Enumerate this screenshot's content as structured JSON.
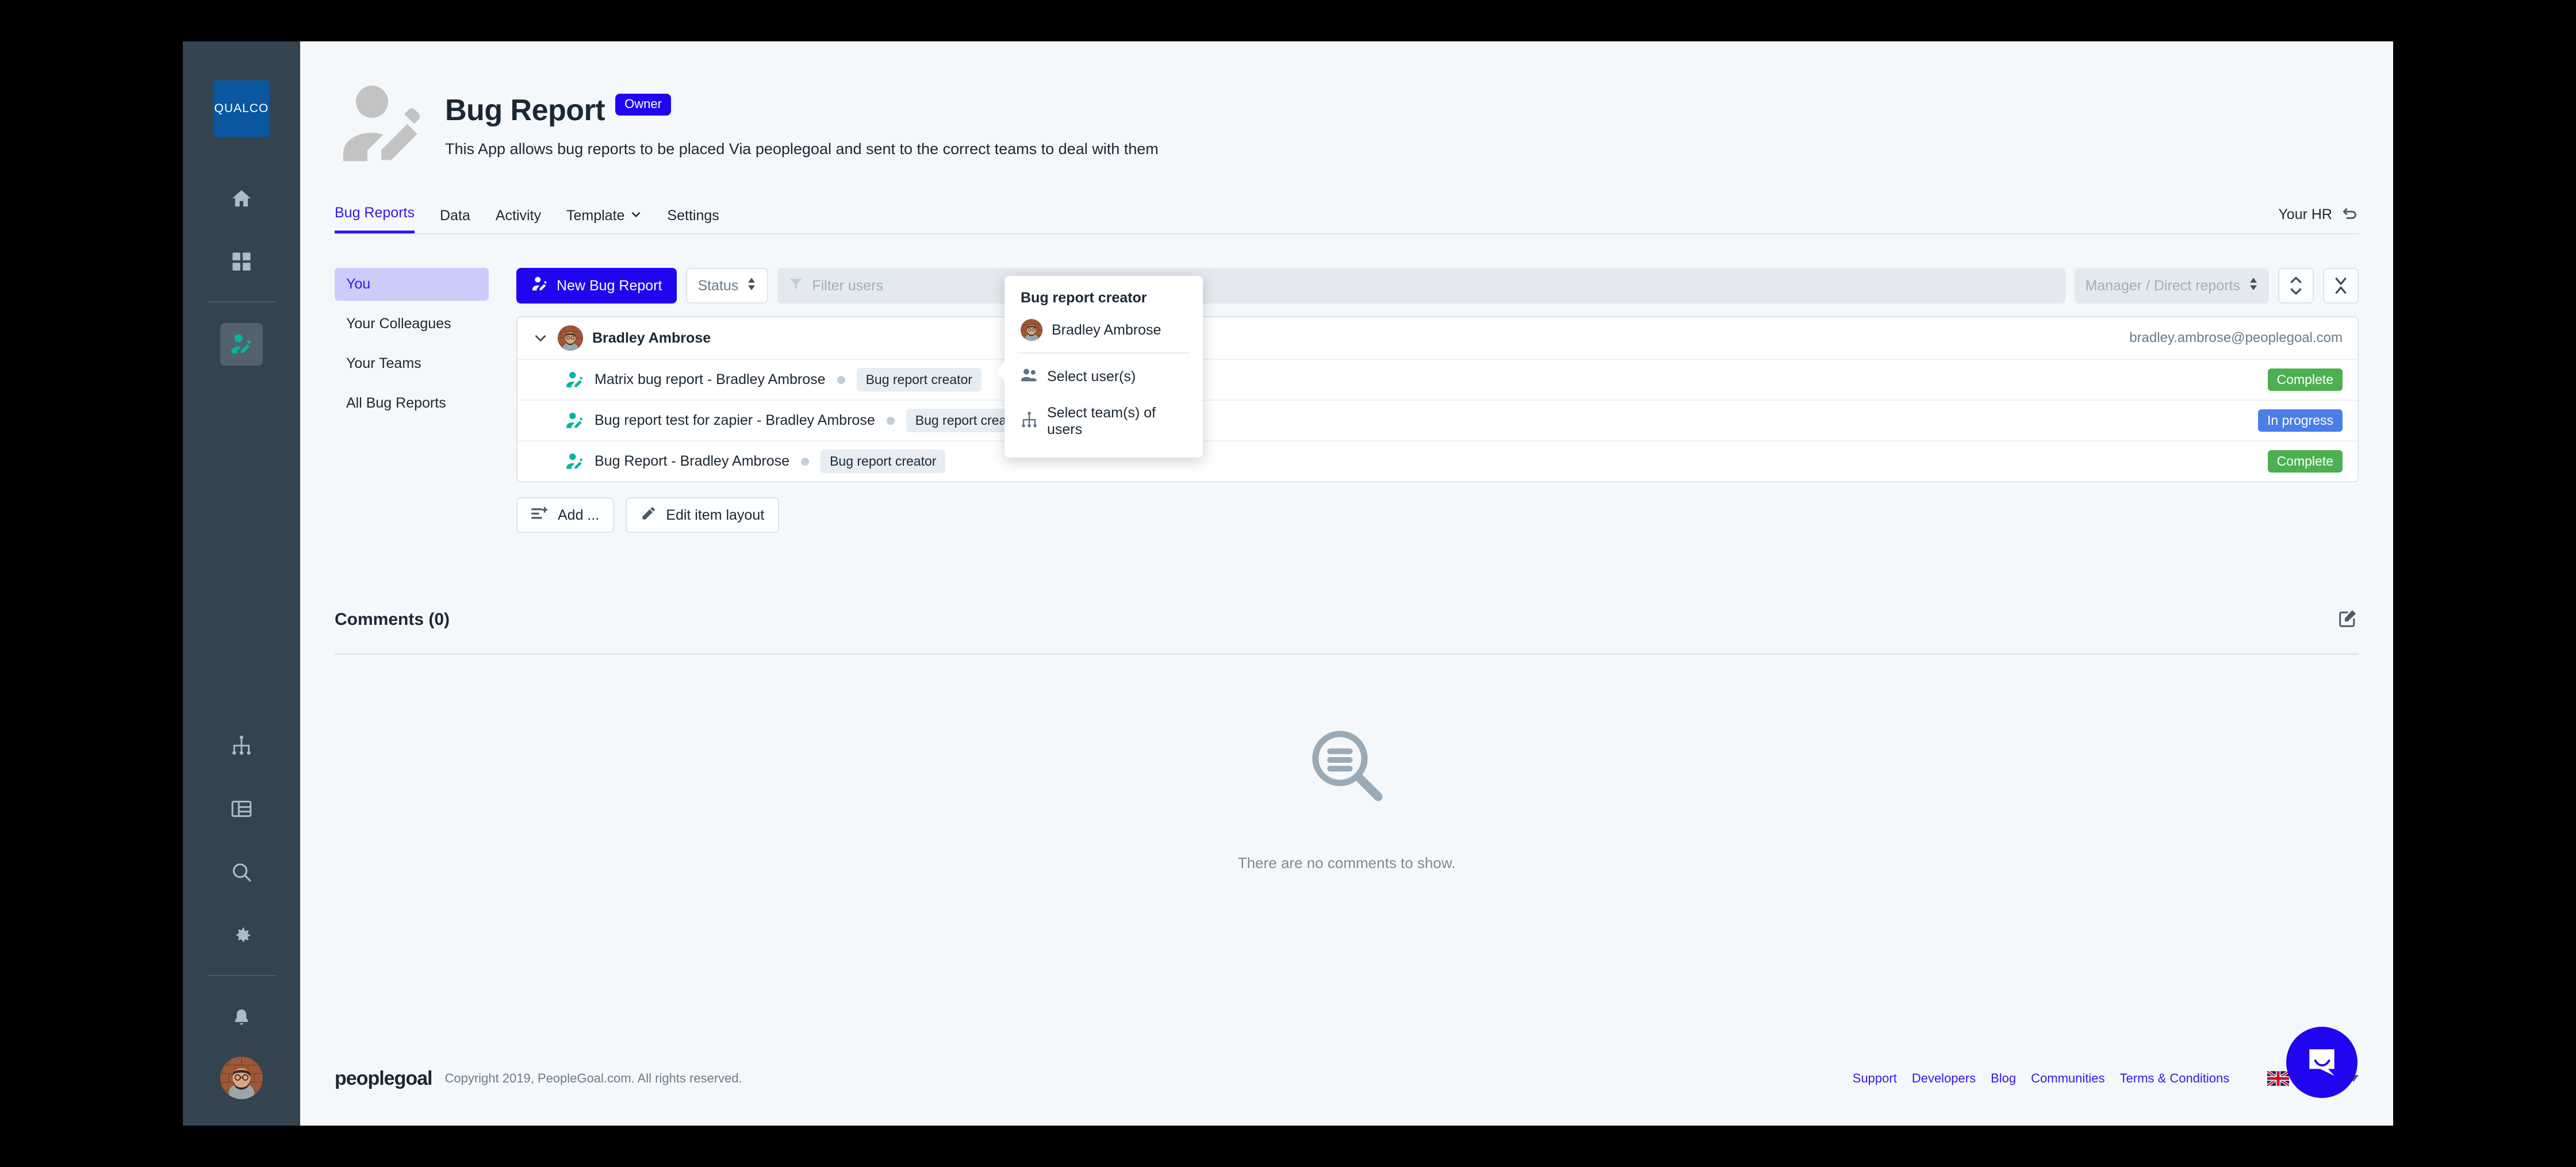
{
  "rail": {
    "brand": "QUALCO",
    "items": [
      {
        "name": "home-icon",
        "label": "Home"
      },
      {
        "name": "apps-grid-icon",
        "label": "Apps"
      },
      {
        "name": "bug-report-app-icon",
        "label": "Bug Report"
      },
      {
        "name": "org-chart-icon",
        "label": "Org chart"
      },
      {
        "name": "table-icon",
        "label": "Reports"
      },
      {
        "name": "search-icon",
        "label": "Search"
      },
      {
        "name": "gear-icon",
        "label": "Settings"
      },
      {
        "name": "bell-icon",
        "label": "Notifications"
      }
    ]
  },
  "header": {
    "title": "Bug Report",
    "badge": "Owner",
    "description": "This App allows bug reports to be placed Via peoplegoal and sent to the correct teams to deal with them"
  },
  "tabs": {
    "items": [
      {
        "label": "Bug Reports",
        "active": true,
        "caret": false
      },
      {
        "label": "Data",
        "active": false,
        "caret": false
      },
      {
        "label": "Activity",
        "active": false,
        "caret": false
      },
      {
        "label": "Template",
        "active": false,
        "caret": true
      },
      {
        "label": "Settings",
        "active": false,
        "caret": false
      }
    ],
    "right_label": "Your HR"
  },
  "sidebar_filters": {
    "items": [
      {
        "label": "You",
        "active": true
      },
      {
        "label": "Your Colleagues",
        "active": false
      },
      {
        "label": "Your Teams",
        "active": false
      },
      {
        "label": "All Bug Reports",
        "active": false
      }
    ]
  },
  "toolbar": {
    "new_button": "New Bug Report",
    "status_select": "Status",
    "filter_placeholder": "Filter users",
    "manager_select": "Manager / Direct reports",
    "expand_collapse_icon": "expand-collapse-icon",
    "collapse_all_icon": "collapse-all-icon"
  },
  "results": {
    "group": {
      "name": "Bradley Ambrose",
      "email": "bradley.ambrose@peoplegoal.com",
      "expanded": true
    },
    "rows": [
      {
        "name": "Matrix bug report - Bradley Ambrose",
        "chip": "Bug report creator",
        "status": "Complete",
        "status_color": "#4caf50"
      },
      {
        "name": "Bug report test for zapier - Bradley Ambrose",
        "chip": "Bug report creator",
        "status": "In progress",
        "status_color": "#4a7fe8"
      },
      {
        "name": "Bug Report - Bradley Ambrose",
        "chip": "Bug report creator",
        "status": "Complete",
        "status_color": "#4caf50"
      }
    ]
  },
  "actions": {
    "add_label": "Add ...",
    "edit_layout_label": "Edit item layout"
  },
  "popover": {
    "title": "Bug report creator",
    "user": "Bradley Ambrose",
    "options": [
      {
        "label": "Select user(s)",
        "icon": "users-icon"
      },
      {
        "label": "Select team(s) of users",
        "icon": "team-tree-icon"
      }
    ]
  },
  "comments": {
    "title": "Comments (0)",
    "empty_text": "There are no comments to show.",
    "edit_icon": "edit-square-icon"
  },
  "footer": {
    "logo": "peoplegoal",
    "copyright": "Copyright 2019, PeopleGoal.com. All rights reserved.",
    "links": [
      "Support",
      "Developers",
      "Blog",
      "Communities",
      "Terms & Conditions"
    ],
    "language": "English"
  },
  "colors": {
    "primary": "#1f06ef",
    "accent_link": "#2f19f3",
    "rail_bg": "#33434f",
    "teal": "#00b6a0",
    "complete": "#4caf50",
    "in_progress": "#4a7fe8"
  }
}
